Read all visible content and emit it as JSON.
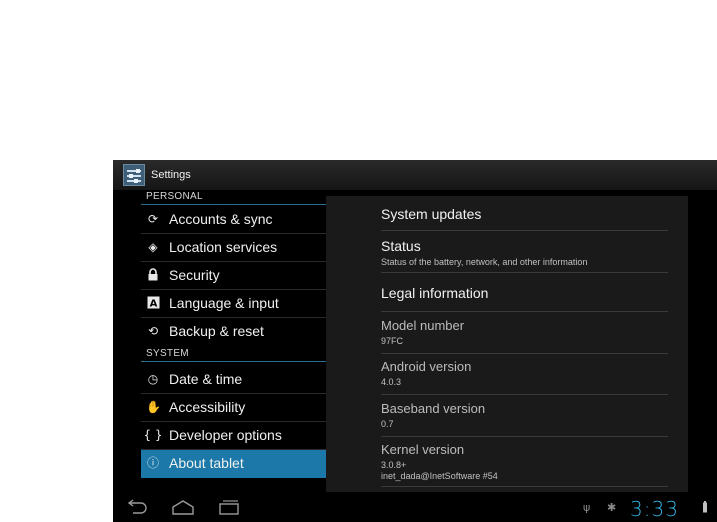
{
  "header": {
    "title": "Settings",
    "icon": "settings-icon"
  },
  "sidebar": {
    "sections": [
      {
        "label": "PERSONAL"
      },
      {
        "label": "SYSTEM"
      }
    ],
    "personal_items": [
      {
        "label": "Accounts & sync",
        "icon": "sync-icon",
        "glyph": "⟳"
      },
      {
        "label": "Location services",
        "icon": "location-icon",
        "glyph": "◈"
      },
      {
        "label": "Security",
        "icon": "lock-icon",
        "glyph": "🔒"
      },
      {
        "label": "Language & input",
        "icon": "keyboard-icon",
        "glyph": "A"
      },
      {
        "label": "Backup & reset",
        "icon": "backup-icon",
        "glyph": "⟲"
      }
    ],
    "system_items": [
      {
        "label": "Date & time",
        "icon": "clock-icon",
        "glyph": "◷"
      },
      {
        "label": "Accessibility",
        "icon": "hand-icon",
        "glyph": "✋"
      },
      {
        "label": "Developer options",
        "icon": "braces-icon",
        "glyph": "{ }"
      },
      {
        "label": "About tablet",
        "icon": "info-icon",
        "glyph": "ⓘ",
        "selected": true
      }
    ]
  },
  "about": {
    "items": [
      {
        "title": "System updates",
        "subtitle": ""
      },
      {
        "title": "Status",
        "subtitle": "Status of the battery, network, and other information"
      },
      {
        "title": "Legal information",
        "subtitle": ""
      },
      {
        "title": "Model number",
        "subtitle": "97FC"
      },
      {
        "title": "Android version",
        "subtitle": "4.0.3"
      },
      {
        "title": "Baseband version",
        "subtitle": "0.7"
      },
      {
        "title": "Kernel version",
        "subtitle": "3.0.8+",
        "subtitle2": "inet_dada@InetSoftware #54"
      }
    ]
  },
  "statusbar": {
    "time": "3:33",
    "icons": [
      "usb-icon",
      "android-debug-icon",
      "battery-icon"
    ],
    "nav": [
      "back-icon",
      "home-icon",
      "recent-apps-icon"
    ]
  },
  "colors": {
    "accent": "#33b5e5",
    "selected": "#1b78a8",
    "background": "#000000"
  }
}
